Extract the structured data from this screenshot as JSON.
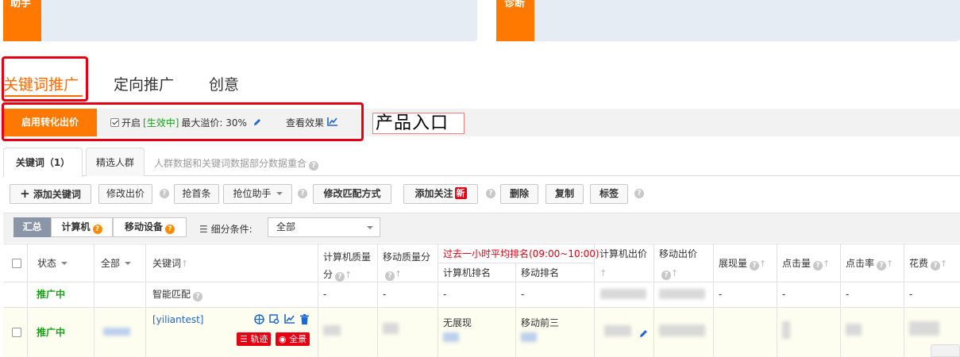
{
  "top_cards": {
    "assistant_tag": "助手",
    "diagnose_tag": "诊断"
  },
  "main_tabs": {
    "keyword": "关键词推广",
    "target": "定向推广",
    "creative": "创意"
  },
  "conversion_bar": {
    "button": "启用转化出价",
    "enabled_label": "开启",
    "status": "[生效中]",
    "max_premium": "最大溢价: 30%",
    "view_effect": "查看效果"
  },
  "product_entry": "产品入口",
  "sub_tabs": {
    "keywords": "关键词（1）",
    "crowd": "精选人群",
    "note": "人群数据和关键词数据部分数据重合"
  },
  "toolbar": {
    "add_keyword": "添加关键词",
    "edit_bid": "修改出价",
    "grab_first": "抢首条",
    "rank_assistant": "抢位助手",
    "edit_match": "修改匹配方式",
    "add_follow": "添加关注",
    "new_badge": "新",
    "delete": "删除",
    "copy": "复制",
    "label": "标签"
  },
  "filter_bar": {
    "summary": "汇总",
    "pc": "计算机",
    "mobile": "移动设备",
    "condition_label": "细分条件:",
    "condition_value": "全部"
  },
  "table": {
    "headers": {
      "status": "状态",
      "all": "全部",
      "keyword": "关键词",
      "pc_quality": "计算机质量分",
      "mobile_quality": "移动质量分",
      "rank_group": "过去一小时平均排名(09:00~10:00)",
      "pc_rank": "计算机排名",
      "mobile_rank": "移动排名",
      "pc_bid": "计算机出价",
      "mobile_bid": "移动出价",
      "impressions": "展现量",
      "clicks": "点击量",
      "ctr": "点击率",
      "cost": "花费"
    },
    "rows": [
      {
        "status": "推广中",
        "keyword": "智能匹配",
        "pc_quality": "-",
        "mobile_quality": "-",
        "pc_rank": "-",
        "mobile_rank": "-",
        "impressions": "-",
        "clicks": "-",
        "ctr": "-",
        "cost": "-"
      },
      {
        "status": "推广中",
        "keyword": "[yiliantest]",
        "tag_track": "轨迹",
        "tag_panorama": "全景",
        "pc_rank": "无展现",
        "mobile_rank": "移动前三"
      }
    ]
  },
  "colors": {
    "accent_orange": "#ff7800",
    "status_green": "#1aa01a",
    "alert_red": "#e60012",
    "link_blue": "#1e66d0"
  }
}
